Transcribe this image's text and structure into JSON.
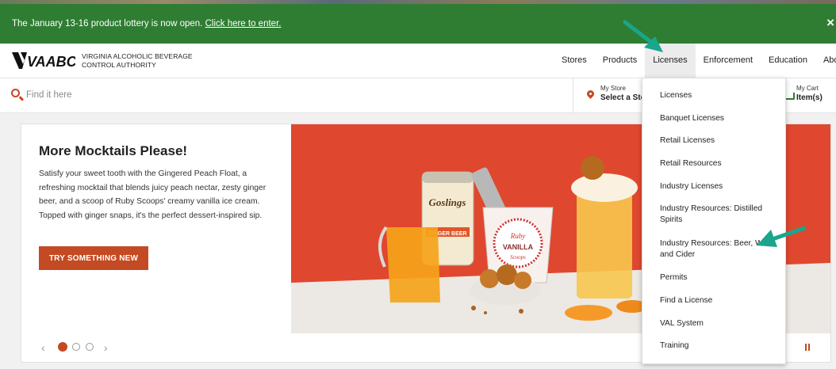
{
  "promo": {
    "text": "The January 13-16 product lottery is now open.",
    "link": "Click here to enter.",
    "close": "×"
  },
  "header": {
    "logo": "VAABC",
    "org_line1": "Virginia Alcoholic Beverage",
    "org_line2": "Control Authority",
    "nav": [
      "Stores",
      "Products",
      "Licenses",
      "Enforcement",
      "Education",
      "About"
    ],
    "active_nav": "Licenses"
  },
  "search": {
    "placeholder": "Find it here"
  },
  "store": {
    "label": "My Store",
    "value": "Select a Sto"
  },
  "cart": {
    "label": "My Cart",
    "value": "Item(s)"
  },
  "hero": {
    "title": "More Mocktails Please!",
    "body": "Satisfy your sweet tooth with the Gingered Peach Float, a refreshing mocktail that blends juicy peach nectar, zesty ginger beer, and a scoop of Ruby Scoops' creamy vanilla ice cream. Topped with ginger snaps, it's the perfect dessert-inspired sip.",
    "cta": "TRY SOMETHING NEW",
    "can_label": "Goslings",
    "can_sub": "GINGER BEER",
    "cup_brand": "Ruby",
    "cup_flavor": "VANILLA",
    "cup_sub": "Scoops"
  },
  "carousel": {
    "prev": "‹",
    "next": "›",
    "slides": 3,
    "active_slide": 1
  },
  "licenses_menu": [
    "Licenses",
    "Banquet Licenses",
    "Retail Licenses",
    "Retail Resources",
    "Industry Licenses",
    "Industry Resources: Distilled Spirits",
    "Industry Resources: Beer, Wine and Cider",
    "Permits",
    "Find a License",
    "VAL System",
    "Training"
  ],
  "colors": {
    "promo_green": "#2f7d32",
    "brand_orange": "#c34a22",
    "hero_red": "#e0472f",
    "annotation_teal": "#1aa58c"
  }
}
